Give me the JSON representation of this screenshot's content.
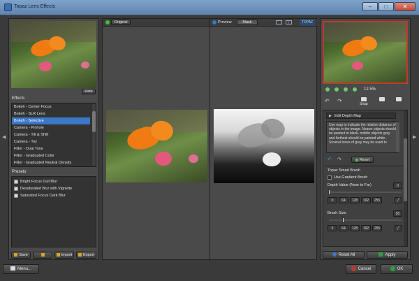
{
  "app": {
    "title": "Topaz Lens Effects"
  },
  "left": {
    "hide_label": "Hide",
    "effects_header": "Effects",
    "effects": [
      "Bokeh - Center Focus",
      "Bokeh - SLR Lens",
      "Bokeh - Selective",
      "Camera - Pinhole",
      "Camera - Tilt & Shift",
      "Camera - Toy",
      "Filter - Dual Tone",
      "Filter - Graduated Color",
      "Filter - Graduated Neutral Density"
    ],
    "effects_selected_index": 2,
    "presets_header": "Presets",
    "presets": [
      "Bright Focus Dull Blur",
      "Desaturated Blur with Vignette",
      "Saturated Focus Dark Blur"
    ],
    "buttons": {
      "save": "Save",
      "import": "Import",
      "export": "Export"
    }
  },
  "center": {
    "tab_original": "Original",
    "tab_preview": "Preview",
    "tab_mask": "Mask"
  },
  "right": {
    "zoom_level": "12.5%",
    "snap_label": "Snap",
    "edit_depth_map": "Edit Depth Map",
    "instructions": "Use map to indicate the relative distance of objects in the image. Nearer objects should be painted in black, middle objects gray and farthest should be painted white. Several tones of gray may be used to",
    "reset_label": "Reset",
    "smart_brush_header": "Topaz Smart Brush",
    "gradient_brush_label": "Use Gradient Brush",
    "depth_value_label": "Depth Value (Near to Far)",
    "depth_value": "0",
    "depth_presets": [
      "0",
      "64",
      "128",
      "192",
      "255"
    ],
    "brush_size_label": "Brush Size",
    "brush_size": "50",
    "brush_presets": [
      "5",
      "64",
      "128",
      "192",
      "255"
    ],
    "reset_all_label": "Reset All",
    "apply_label": "Apply"
  },
  "bottom": {
    "menu_label": "Menu...",
    "cancel_label": "Cancel",
    "ok_label": "OK"
  },
  "colors": {
    "accent_blue": "#3a78c8",
    "cancel_red": "#c0392b",
    "ok_green": "#2ea043"
  }
}
